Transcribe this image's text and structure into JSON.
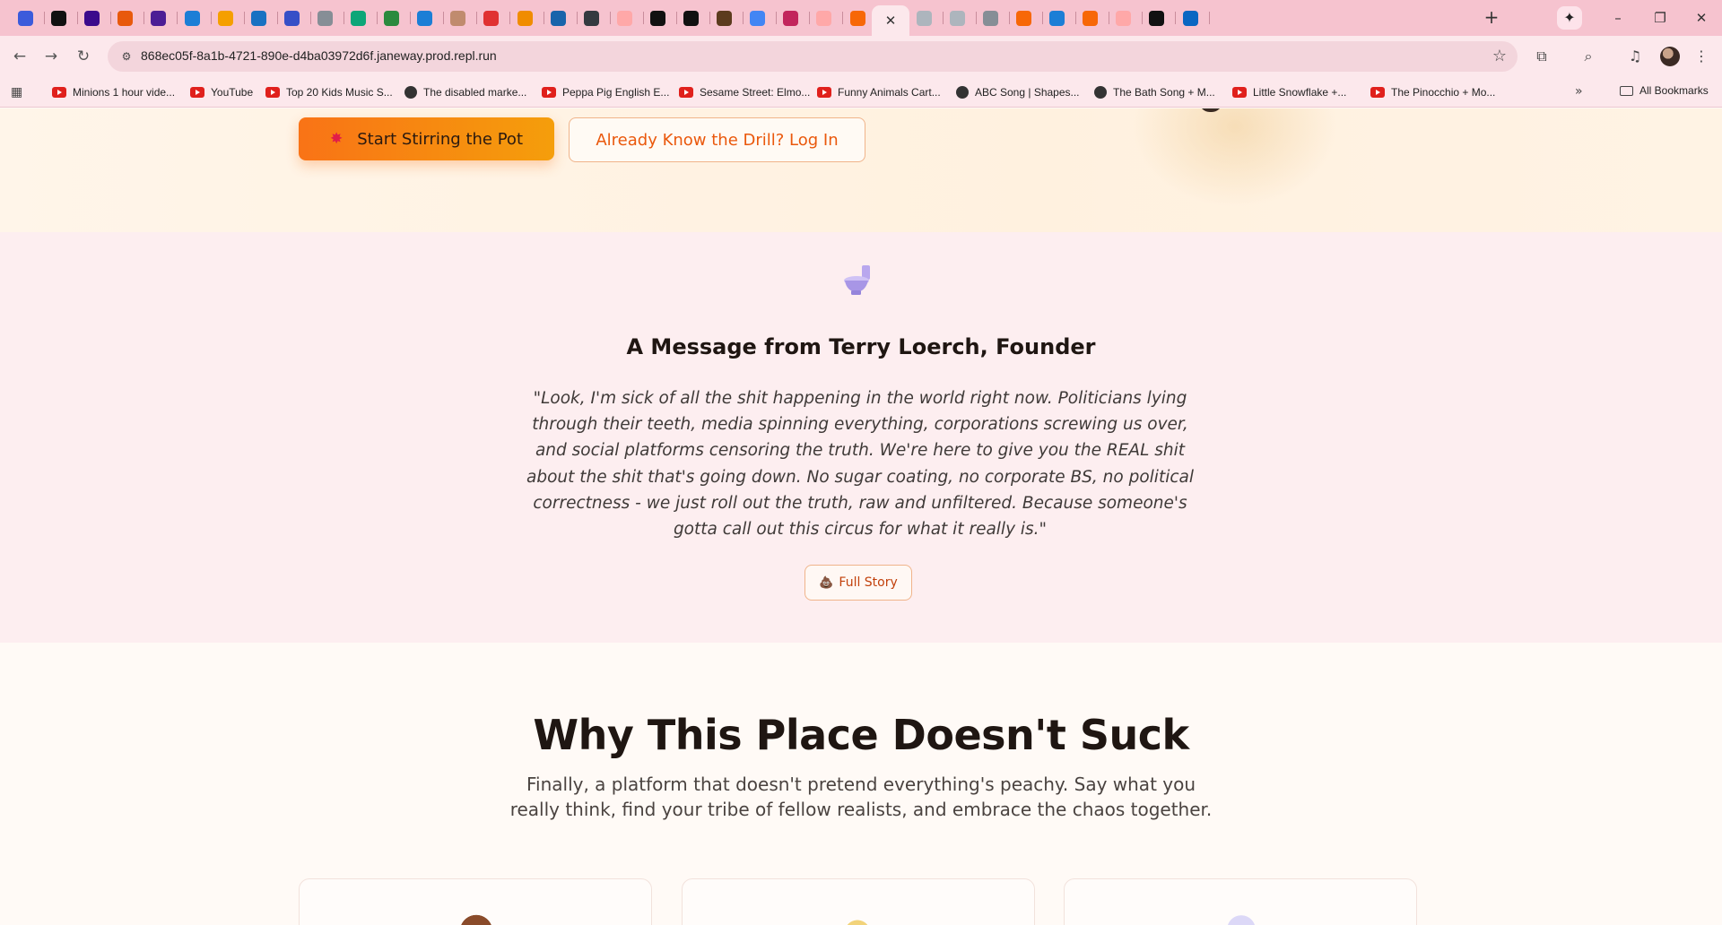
{
  "browser": {
    "tabs": [
      {
        "icon": "heart-shield-icon",
        "color": "#3b5bdb"
      },
      {
        "icon": "capcut-icon",
        "color": "#111111"
      },
      {
        "icon": "spotify-icon",
        "color": "#3b0a8c"
      },
      {
        "icon": "pen-icon",
        "color": "#e8590c"
      },
      {
        "icon": "bot-icon",
        "color": "#4c1d95"
      },
      {
        "icon": "blocks-icon",
        "color": "#1c7ed6"
      },
      {
        "icon": "tools-icon",
        "color": "#f59f00"
      },
      {
        "icon": "circle-icon",
        "color": "#1971c2"
      },
      {
        "icon": "chart-icon",
        "color": "#364fc7"
      },
      {
        "icon": "arrow-icon",
        "color": "#868e96"
      },
      {
        "icon": "openai-icon",
        "color": "#0ca678"
      },
      {
        "icon": "star-icon",
        "color": "#2b8a3e"
      },
      {
        "icon": "k-icon",
        "color": "#1c7ed6"
      },
      {
        "icon": "face-icon",
        "color": "#c08b6e"
      },
      {
        "icon": "mask-icon",
        "color": "#e03131"
      },
      {
        "icon": "stack-icon",
        "color": "#f08c00"
      },
      {
        "icon": "hp-icon",
        "color": "#1864ab"
      },
      {
        "icon": "a-icon",
        "color": "#343a40"
      },
      {
        "icon": "ring-icon",
        "color": "#ffa8a8"
      },
      {
        "icon": "medium-icon",
        "color": "#111111"
      },
      {
        "icon": "sparkle-icon",
        "color": "#111111"
      },
      {
        "icon": "hand-icon",
        "color": "#5c3b1e"
      },
      {
        "icon": "google-icon",
        "color": "#4285f4"
      },
      {
        "icon": "mix-icon",
        "color": "#c2255c"
      },
      {
        "icon": "ring-icon",
        "color": "#ffa8a8"
      },
      {
        "icon": "replit-icon",
        "color": "#f76707"
      },
      {
        "icon": "active-tab",
        "color": "#fce8ec"
      },
      {
        "icon": "ghost-icon",
        "color": "#adb5bd"
      },
      {
        "icon": "ghost-icon",
        "color": "#adb5bd"
      },
      {
        "icon": "gear-icon",
        "color": "#868e96"
      },
      {
        "icon": "replit-icon",
        "color": "#f76707"
      },
      {
        "icon": "blocks-icon",
        "color": "#1c7ed6"
      },
      {
        "icon": "sz-icon",
        "color": "#f76707"
      },
      {
        "icon": "ring-icon",
        "color": "#ffa8a8"
      },
      {
        "icon": "capcut-icon",
        "color": "#111111"
      },
      {
        "icon": "linkedin-icon",
        "color": "#0a66c2"
      }
    ],
    "url": "868ec05f-8a1b-4721-890e-d4ba03972d6f.janeway.prod.repl.run",
    "bookmarks": [
      "Minions 1 hour vide...",
      "YouTube",
      "Top 20 Kids Music S...",
      "The disabled marke...",
      "Peppa Pig English E...",
      "Sesame Street: Elmo...",
      "Funny Animals Cart...",
      "ABC Song | Shapes...",
      "The Bath Song + M...",
      "Little Snowflake +...",
      "The Pinocchio + Mo..."
    ],
    "all_bookmarks": "All Bookmarks"
  },
  "hero": {
    "primary_button": "Start Stirring the Pot",
    "secondary_button": "Already Know the Drill? Log In"
  },
  "founder": {
    "title": "A Message from Terry Loerch, Founder",
    "quote": "\"Look, I'm sick of all the shit happening in the world right now. Politicians lying through their teeth, media spinning everything, corporations screwing us over, and social platforms censoring the truth. We're here to give you the REAL shit about the shit that's going down. No sugar coating, no corporate BS, no political correctness - we just roll out the truth, raw and unfiltered. Because someone's gotta call out this circus for what it really is.\"",
    "story_button": "Full Story"
  },
  "why": {
    "title": "Why This Place Doesn't Suck",
    "subtitle": "Finally, a platform that doesn't pretend everything's peachy. Say what you really think, find your tribe of fellow realists, and embrace the chaos together."
  },
  "cards": [
    {
      "icon": "poop-icon",
      "color": "#8a4b2a"
    },
    {
      "icon": "megaphone-icon",
      "color": "#f2c94c"
    },
    {
      "icon": "crystal-ball-icon",
      "color": "#c9c3f2"
    }
  ]
}
